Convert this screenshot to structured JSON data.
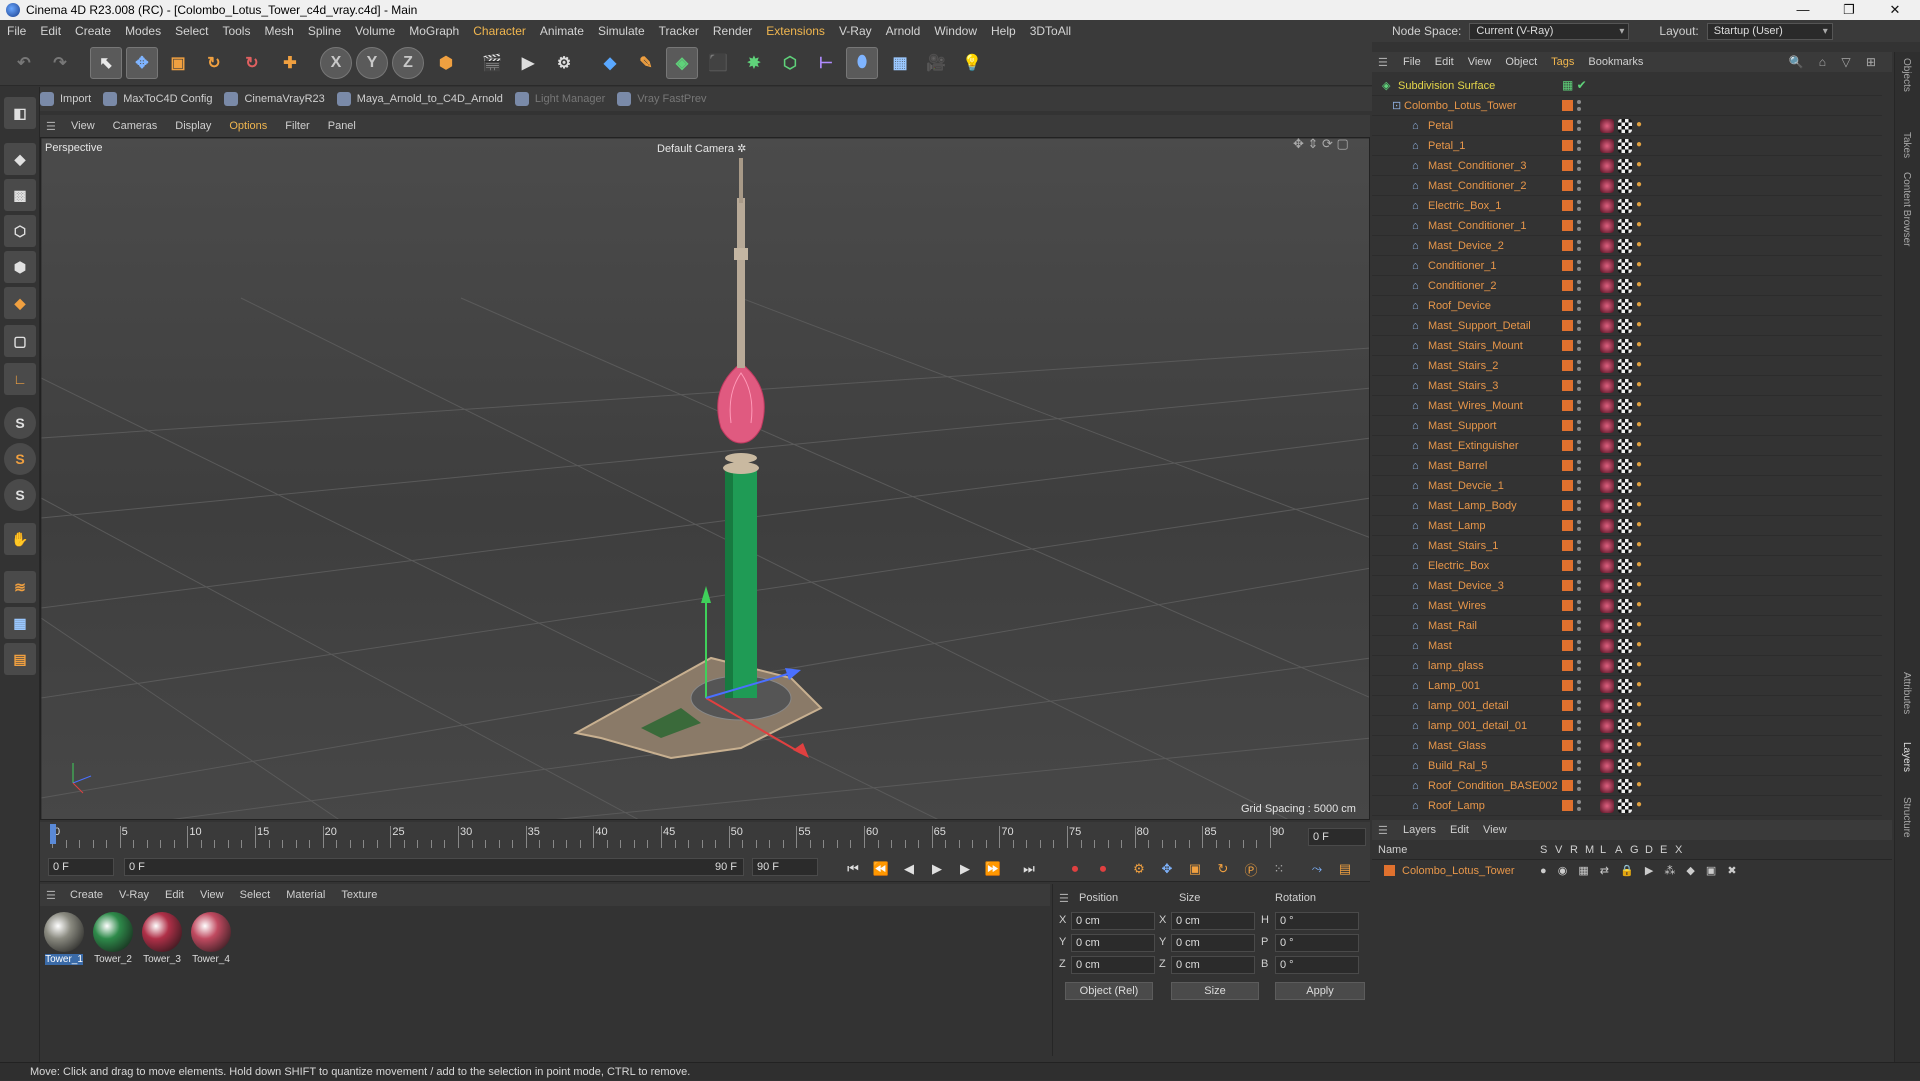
{
  "window": {
    "title": "Cinema 4D R23.008 (RC) - [Colombo_Lotus_Tower_c4d_vray.c4d] - Main",
    "min_glyph": "—",
    "max_glyph": "❐",
    "close_glyph": "✕"
  },
  "menu": [
    "File",
    "Edit",
    "Create",
    "Modes",
    "Select",
    "Tools",
    "Mesh",
    "Spline",
    "Volume",
    "MoGraph",
    "Character",
    "Animate",
    "Simulate",
    "Tracker",
    "Render",
    "Extensions",
    "V-Ray",
    "Arnold",
    "Window",
    "Help",
    "3DToAll"
  ],
  "nodespace": {
    "label": "Node Space:",
    "value": "Current (V-Ray)",
    "layout_label": "Layout:",
    "layout_value": "Startup (User)"
  },
  "plugins": [
    {
      "label": "Import",
      "dim": false
    },
    {
      "label": "MaxToC4D Config",
      "dim": false
    },
    {
      "label": "CinemaVrayR23",
      "dim": false
    },
    {
      "label": "Maya_Arnold_to_C4D_Arnold",
      "dim": false
    },
    {
      "label": "Light Manager",
      "dim": true
    },
    {
      "label": "Vray FastPrev",
      "dim": true
    }
  ],
  "toolbar_glyphs": {
    "x": "X",
    "y": "Y",
    "z": "Z"
  },
  "viewmenu": [
    "View",
    "Cameras",
    "Display",
    "Options",
    "Filter",
    "Panel"
  ],
  "viewport": {
    "view_name": "Perspective",
    "camera": "Default Camera",
    "camera_glyph": "✲",
    "grid_spacing": "Grid Spacing : 5000 cm"
  },
  "timeline": {
    "ticks": [
      "0",
      "5",
      "10",
      "15",
      "20",
      "25",
      "30",
      "35",
      "40",
      "45",
      "50",
      "55",
      "60",
      "65",
      "70",
      "75",
      "80",
      "85",
      "90"
    ],
    "current_frame": "0 F",
    "start": "0 F",
    "range_start": "0 F",
    "range_end": "90 F",
    "end": "90 F",
    "end2": "90 F"
  },
  "matmenu": [
    "Create",
    "V-Ray",
    "Edit",
    "View",
    "Select",
    "Material",
    "Texture"
  ],
  "materials": [
    {
      "name": "Tower_1",
      "color": "#8a8a80",
      "selected": true
    },
    {
      "name": "Tower_2",
      "color": "#2e8a4a",
      "selected": false
    },
    {
      "name": "Tower_3",
      "color": "#b03048",
      "selected": false
    },
    {
      "name": "Tower_4",
      "color": "#c04a60",
      "selected": false
    }
  ],
  "coords": {
    "headers": [
      "Position",
      "Size",
      "Rotation"
    ],
    "rows": [
      {
        "axis": "X",
        "pos": "0 cm",
        "size_axis": "X",
        "size": "0 cm",
        "rot_axis": "H",
        "rot": "0 °"
      },
      {
        "axis": "Y",
        "pos": "0 cm",
        "size_axis": "Y",
        "size": "0 cm",
        "rot_axis": "P",
        "rot": "0 °"
      },
      {
        "axis": "Z",
        "pos": "0 cm",
        "size_axis": "Z",
        "size": "0 cm",
        "rot_axis": "B",
        "rot": "0 °"
      }
    ],
    "mode": "Object (Rel)",
    "size_mode": "Size",
    "apply": "Apply"
  },
  "status": "Move: Click and drag to move elements. Hold down SHIFT to quantize movement / add to the selection in point mode, CTRL to remove.",
  "objmenu": [
    "File",
    "Edit",
    "View",
    "Object",
    "Tags",
    "Bookmarks"
  ],
  "objects": {
    "top": "Subdivision Surface",
    "root": "Colombo_Lotus_Tower",
    "children": [
      "Petal",
      "Petal_1",
      "Mast_Conditioner_3",
      "Mast_Conditioner_2",
      "Electric_Box_1",
      "Mast_Conditioner_1",
      "Mast_Device_2",
      "Conditioner_1",
      "Conditioner_2",
      "Roof_Device",
      "Mast_Support_Detail",
      "Mast_Stairs_Mount",
      "Mast_Stairs_2",
      "Mast_Stairs_3",
      "Mast_Wires_Mount",
      "Mast_Support",
      "Mast_Extinguisher",
      "Mast_Barrel",
      "Mast_Devcie_1",
      "Mast_Lamp_Body",
      "Mast_Lamp",
      "Mast_Stairs_1",
      "Electric_Box",
      "Mast_Device_3",
      "Mast_Wires",
      "Mast_Rail",
      "Mast",
      "lamp_glass",
      "Lamp_001",
      "lamp_001_detail",
      "lamp_001_detail_01",
      "Mast_Glass",
      "Build_Ral_5",
      "Roof_Condition_BASE002",
      "Roof_Lamp"
    ]
  },
  "right_tabs": [
    "Objects",
    "Takes",
    "Content Browser",
    "Attributes",
    "Layers",
    "Structure"
  ],
  "layersmenu": [
    "Layers",
    "Edit",
    "View"
  ],
  "layer_columns": [
    "Name",
    "S",
    "V",
    "R",
    "M",
    "L",
    "A",
    "G",
    "D",
    "E",
    "X"
  ],
  "layer": {
    "name": "Colombo_Lotus_Tower",
    "color": "#e0712e"
  }
}
